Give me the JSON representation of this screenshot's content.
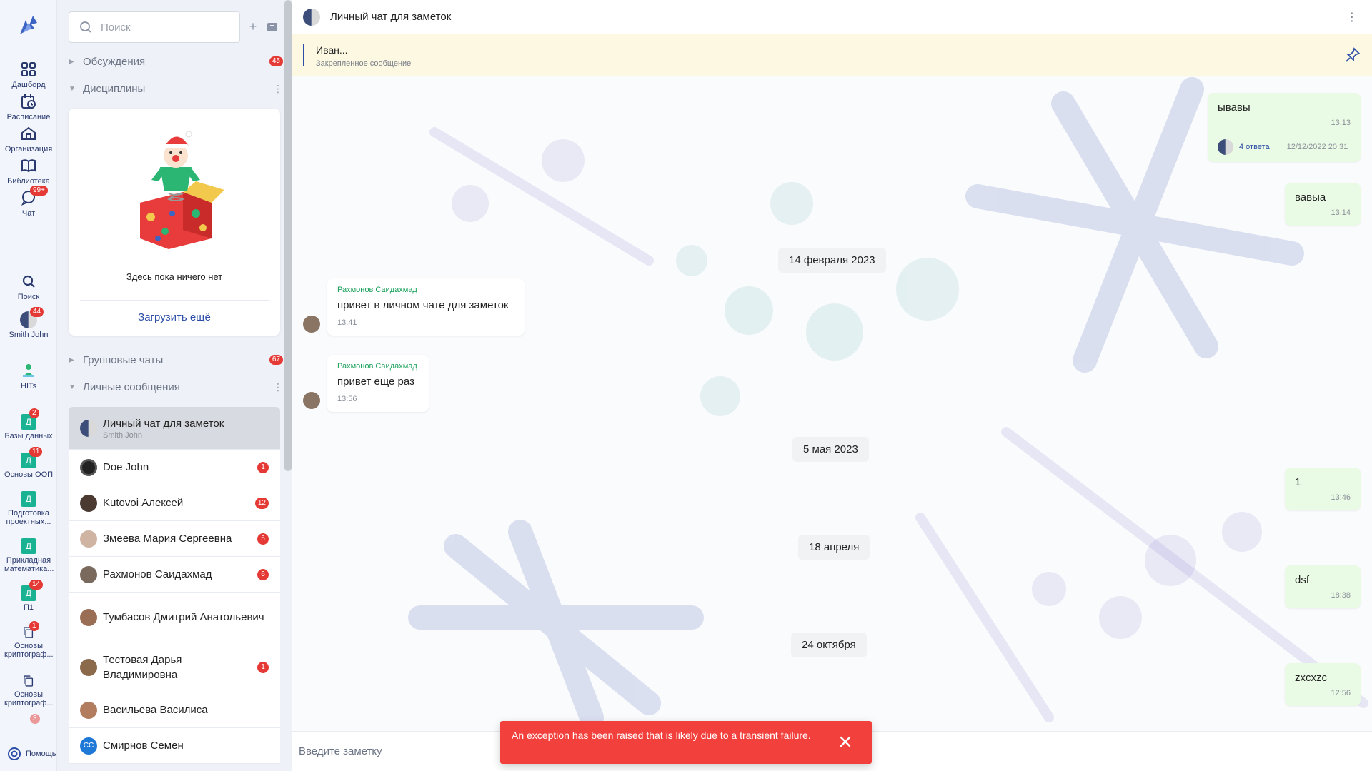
{
  "rail": {
    "items": [
      {
        "label": "Дашборд",
        "icon": "dashboard-icon"
      },
      {
        "label": "Расписание",
        "icon": "schedule-icon"
      },
      {
        "label": "Организация",
        "icon": "organization-icon"
      },
      {
        "label": "Библиотека",
        "icon": "library-icon"
      },
      {
        "label": "Чат",
        "icon": "chat-icon",
        "badge": "99+"
      },
      {
        "label": "Поиск",
        "icon": "search-icon"
      },
      {
        "label": "Smith John",
        "icon": "avatar",
        "badge": "44"
      },
      {
        "label": "HITs",
        "icon": "hits-icon"
      },
      {
        "label": "Базы данных",
        "icon": "course-d-icon",
        "badge": "2",
        "glyph": "Д"
      },
      {
        "label": "Основы ООП",
        "icon": "course-d-icon",
        "badge": "11",
        "glyph": "Д"
      },
      {
        "label": "Подготовка проектных...",
        "icon": "course-d-icon",
        "glyph": "Д"
      },
      {
        "label": "Прикладная математика...",
        "icon": "course-d-icon",
        "glyph": "Д"
      },
      {
        "label": "П1",
        "icon": "course-d-icon",
        "badge": "14",
        "glyph": "Д"
      },
      {
        "label": "Основы криптограф...",
        "icon": "copy-icon",
        "badge": "1"
      },
      {
        "label": "Основы криптограф...",
        "icon": "copy-icon"
      }
    ],
    "hidden_badge": "3",
    "help": "Помощь"
  },
  "sidebar": {
    "search_placeholder": "Поиск",
    "sections": {
      "discussions": {
        "label": "Обсуждения",
        "count": "45"
      },
      "disciplines": {
        "label": "Дисциплины"
      },
      "groups": {
        "label": "Групповые чаты",
        "count": "67"
      },
      "direct": {
        "label": "Личные сообщения"
      }
    },
    "empty_text": "Здесь пока ничего нет",
    "load_more": "Загрузить ещё",
    "chats": [
      {
        "title": "Личный чат для заметок",
        "subtitle": "Smith John",
        "count": "",
        "active": true
      },
      {
        "title": "Doe John",
        "count": "1"
      },
      {
        "title": "Kutovoi Алексей",
        "count": "12"
      },
      {
        "title": "Змеева Мария Сергеевна",
        "count": "5"
      },
      {
        "title": "Рахмонов Саидахмад",
        "count": "6"
      },
      {
        "title": "Тумбасов Дмитрий Анатольевич",
        "count": ""
      },
      {
        "title": "Тестовая Дарья Владимировна",
        "count": "1"
      },
      {
        "title": "Васильева Василиса",
        "count": ""
      },
      {
        "title": "Смирнов Семен",
        "count": "",
        "initials": "СС"
      }
    ]
  },
  "chat": {
    "title": "Личный чат для заметок",
    "pinned": {
      "text": "Иван...",
      "label": "Закрепленное сообщение"
    },
    "messages": {
      "m1": {
        "text": "ывавы",
        "time": "13:13",
        "replies": "4 ответа",
        "reply_date": "12/12/2022 20:31"
      },
      "m2": {
        "text": "вавыа",
        "time": "13:14"
      },
      "d1": "14 февраля 2023",
      "m3": {
        "author": "Рахмонов Саидахмад",
        "text": "привет в личном чате для заметок",
        "time": "13:41"
      },
      "m4": {
        "author": "Рахмонов Саидахмад",
        "text": "привет еще раз",
        "time": "13:56"
      },
      "d2": "5 мая 2023",
      "m5": {
        "text": "1",
        "time": "13:46"
      },
      "d3": "18 апреля",
      "m6": {
        "text": "dsf",
        "time": "18:38"
      },
      "d4": "24 октября",
      "m7": {
        "text": "zxcxzc",
        "time": "12:56"
      }
    },
    "composer_placeholder": "Введите заметку"
  },
  "toast": {
    "message": "An exception has been raised that is likely due to a transient failure."
  },
  "colors": {
    "accent": "#2d4fa8",
    "badge": "#e53935",
    "outgoing_bubble": "#e9fbe4",
    "pinned_bg": "#fdf8e2",
    "toast": "#f2413d",
    "course_tile": "#19b394"
  }
}
